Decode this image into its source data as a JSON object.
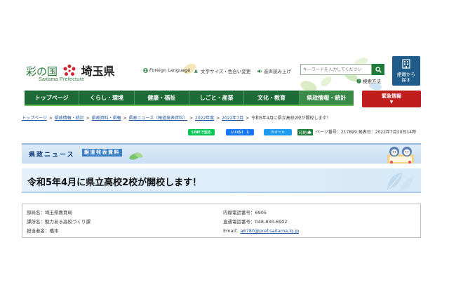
{
  "header": {
    "logo_text_left": "彩の国",
    "logo_text_right": "埼玉県",
    "logo_sub": "Saitama Prefecture",
    "foreign_language": "Foreign Language",
    "text_size": "文字サイズ・色合い変更",
    "voice_read": "音声読み上げ",
    "search_placeholder": "キーワードを入力してください",
    "search_method": "検索方法",
    "org_button_label": "組織から探す",
    "org_line1": "組織から",
    "org_line2": "探す"
  },
  "nav": {
    "items": [
      "トップページ",
      "くらし・環境",
      "健康・福祉",
      "しごと・産業",
      "文化・教育",
      "県政情報・統計"
    ],
    "emergency": "緊急情報"
  },
  "breadcrumb": {
    "items": [
      "トップページ",
      "県政情報・統計",
      "県政資料・県報",
      "県政ニュース（報道発表資料）",
      "2022年度",
      "2022年7月"
    ],
    "current": "令和5年4月に県立高校2校が開校します！"
  },
  "share": {
    "line": "LINEで送る",
    "like": "いいね！ 1",
    "tweet": "ツイート",
    "print": "印刷",
    "page_number": "ページ番号：217899",
    "date": "発表日：2022年7月20日14時"
  },
  "banner": {
    "title": "県政ニュース",
    "tag": "報道発表資料"
  },
  "page": {
    "title": "令和5年4月に県立高校2校が開校します！"
  },
  "info": {
    "dept": "部局名：埼玉県教育局",
    "section": "課所名：魅力ある高校づくり課",
    "person": "担当者名：橋本",
    "ext": "内線電話番号：6905",
    "direct": "直通電話番号：048-830-6902",
    "email_label": "Email：",
    "email": "a6780@pref.saitama.lg.jp"
  },
  "colors": {
    "nav_green": "#1d6b36",
    "emergency_red": "#c01d1d",
    "banner_blue": "#dcebf8",
    "link_blue": "#1a4f9c"
  }
}
